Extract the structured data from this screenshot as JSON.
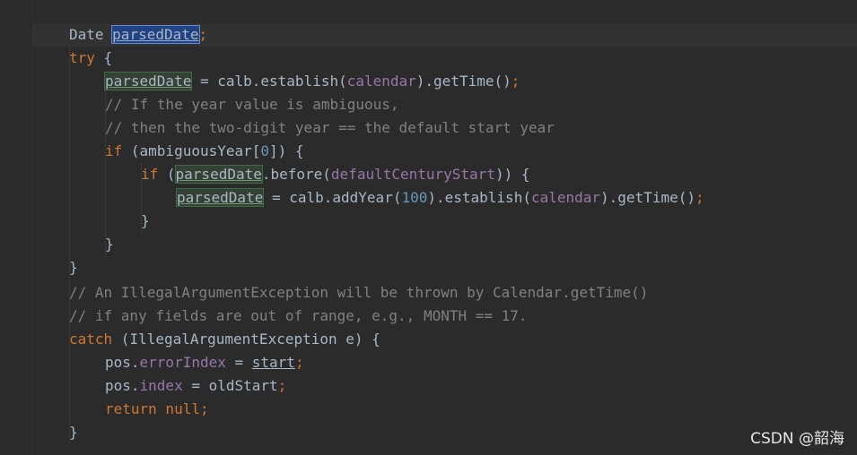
{
  "code_lines": [
    [
      {
        "t": "Date ",
        "c": "plain"
      },
      {
        "t": "parsedDate",
        "c": "plain hl-sel"
      },
      {
        "t": ";",
        "c": "kw"
      }
    ],
    [
      {
        "t": "try",
        "c": "kw"
      },
      {
        "t": " {",
        "c": "plain"
      }
    ],
    [
      {
        "t": "parsedDate",
        "c": "plain hl-w"
      },
      {
        "t": " = calb.establish(",
        "c": "plain"
      },
      {
        "t": "calendar",
        "c": "fld"
      },
      {
        "t": ").getTime()",
        "c": "plain"
      },
      {
        "t": ";",
        "c": "kw"
      }
    ],
    [
      {
        "t": "// If the year value is ambiguous,",
        "c": "cm"
      }
    ],
    [
      {
        "t": "// then the two-digit year == the default start year",
        "c": "cm"
      }
    ],
    [
      {
        "t": "if",
        "c": "kw"
      },
      {
        "t": " (ambiguousYear[",
        "c": "plain"
      },
      {
        "t": "0",
        "c": "num"
      },
      {
        "t": "]) {",
        "c": "plain"
      }
    ],
    [
      {
        "t": "if",
        "c": "kw"
      },
      {
        "t": " (",
        "c": "plain"
      },
      {
        "t": "parsedDate",
        "c": "plain hl-w"
      },
      {
        "t": ".before(",
        "c": "plain"
      },
      {
        "t": "defaultCenturyStart",
        "c": "fld"
      },
      {
        "t": ")) {",
        "c": "plain"
      }
    ],
    [
      {
        "t": "parsedDate",
        "c": "plain hl-w"
      },
      {
        "t": " = calb.addYear(",
        "c": "plain"
      },
      {
        "t": "100",
        "c": "num"
      },
      {
        "t": ").establish(",
        "c": "plain"
      },
      {
        "t": "calendar",
        "c": "fld"
      },
      {
        "t": ").getTime()",
        "c": "plain"
      },
      {
        "t": ";",
        "c": "kw"
      }
    ],
    [
      {
        "t": "}",
        "c": "plain"
      }
    ],
    [
      {
        "t": "}",
        "c": "plain"
      }
    ],
    [
      {
        "t": "}",
        "c": "plain"
      }
    ],
    [
      {
        "t": "// An IllegalArgumentException will be thrown by Calendar.getTime()",
        "c": "cm"
      }
    ],
    [
      {
        "t": "// if any fields are out of range, e.g., MONTH == 17.",
        "c": "cm"
      }
    ],
    [
      {
        "t": "catch",
        "c": "kw"
      },
      {
        "t": " (IllegalArgumentException e) {",
        "c": "plain"
      }
    ],
    [
      {
        "t": "pos.",
        "c": "plain"
      },
      {
        "t": "errorIndex",
        "c": "fld"
      },
      {
        "t": " = ",
        "c": "plain"
      },
      {
        "t": "start",
        "c": "plain ul"
      },
      {
        "t": ";",
        "c": "kw"
      }
    ],
    [
      {
        "t": "pos.",
        "c": "plain"
      },
      {
        "t": "index",
        "c": "fld"
      },
      {
        "t": " = oldStart",
        "c": "plain"
      },
      {
        "t": ";",
        "c": "kw"
      }
    ],
    [
      {
        "t": "return null;",
        "c": "kw"
      }
    ],
    [
      {
        "t": "}",
        "c": "plain"
      }
    ]
  ],
  "watermark": "CSDN @韶海",
  "colors": {
    "background": "#2b2b2b",
    "keyword": "#cc7832",
    "comment": "#808080",
    "field": "#9876aa",
    "number": "#6897bb",
    "text": "#a9b7c6"
  }
}
